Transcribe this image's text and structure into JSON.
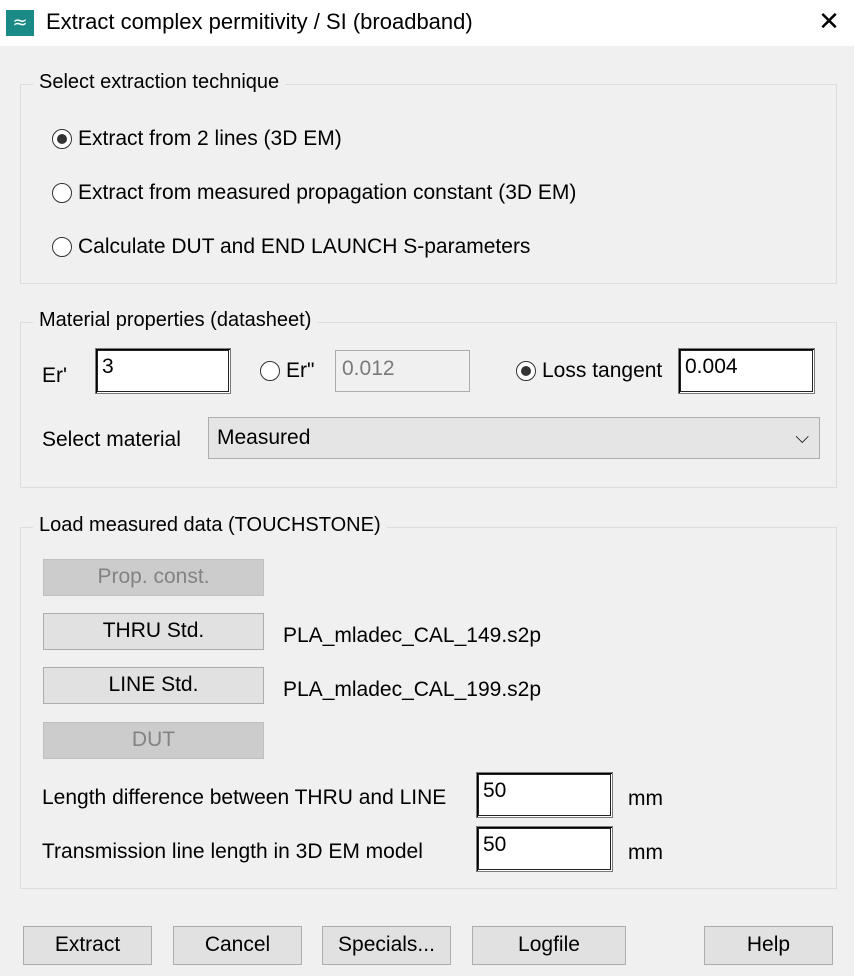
{
  "window": {
    "title": "Extract complex permitivity / SI (broadband)",
    "app_icon_glyph": "≈",
    "close_glyph": "✕"
  },
  "technique": {
    "group_label": "Select extraction technique",
    "options": [
      {
        "label": "Extract from 2 lines (3D EM)",
        "checked": true
      },
      {
        "label": "Extract from measured propagation constant (3D EM)",
        "checked": false
      },
      {
        "label": "Calculate DUT and END LAUNCH S-parameters",
        "checked": false
      }
    ]
  },
  "material": {
    "group_label": "Material properties (datasheet)",
    "er_prime_label": "Er'",
    "er_prime_value": "3",
    "er_double_label": "Er\"",
    "er_double_value": "0.012",
    "er_double_checked": false,
    "loss_tangent_label": "Loss tangent",
    "loss_tangent_value": "0.004",
    "loss_tangent_checked": true,
    "select_label": "Select material",
    "select_value": "Measured",
    "chevron_glyph": "⌵"
  },
  "measured": {
    "group_label": "Load measured data (TOUCHSTONE)",
    "prop_const_label": "Prop. const.",
    "thru_label": "THRU Std.",
    "thru_file": "PLA_mladec_CAL_149.s2p",
    "line_label": "LINE Std.",
    "line_file": "PLA_mladec_CAL_199.s2p",
    "dut_label": "DUT",
    "length_diff_label": "Length difference between THRU and LINE",
    "length_diff_value": "50",
    "length_diff_unit": "mm",
    "tl_length_label": "Transmission line length in 3D EM model",
    "tl_length_value": "50",
    "tl_length_unit": "mm"
  },
  "buttons": {
    "extract": "Extract",
    "cancel": "Cancel",
    "specials": "Specials...",
    "logfile": "Logfile",
    "help": "Help"
  }
}
